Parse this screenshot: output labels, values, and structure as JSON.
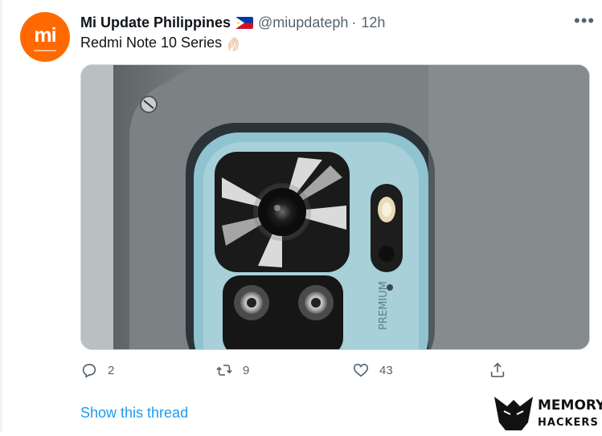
{
  "tweet": {
    "author_name": "Mi Update Philippines",
    "handle": "@miupdateph",
    "separator": "·",
    "time": "12h",
    "text": "Redmi Note 10 Series",
    "avatar_logo_text": "mi",
    "more_label": "•••"
  },
  "image": {
    "engraving": "PREMIUM"
  },
  "actions": {
    "reply_count": "2",
    "retweet_count": "9",
    "like_count": "43"
  },
  "thread_link": "Show this thread",
  "watermark": {
    "line1": "MEMORY",
    "line2": "HACKERS"
  },
  "colors": {
    "avatar": "#ff6900",
    "link": "#1d9bf0",
    "muted": "#536471",
    "phone_body": "#8fc3cf"
  },
  "icons": [
    "more-icon",
    "reply-icon",
    "retweet-icon",
    "like-icon",
    "share-icon",
    "ph-flag-icon",
    "ok-hand-icon"
  ]
}
